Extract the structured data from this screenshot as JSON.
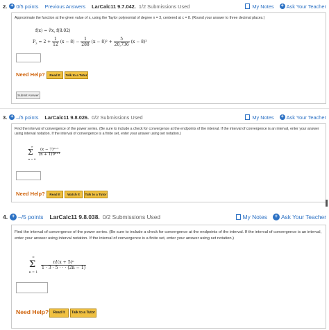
{
  "q2": {
    "number": "2.",
    "points": "0/5 points",
    "previous": "Previous Answers",
    "code": "LarCalc11 9.7.042.",
    "submissions": "1/2 Submissions Used",
    "my_notes": "My Notes",
    "ask_teacher": "Ask Your Teacher",
    "instructions": "Approximate the function at the given value of x, using the Taylor polynomial of degree n = 3, centered at c = 8. (Round your answer to three decimal places.)",
    "func": "f(x) = ∛x,  f(8.02)",
    "p3_lhs": "P",
    "p3_sub": "3",
    "p3_t0": "= 2 +",
    "p3_f1_num": "1",
    "p3_f1_den": "12",
    "p3_t1": "(x − 8) −",
    "p3_f2_num": "1",
    "p3_f2_den": "288",
    "p3_t2": "(x − 8)² +",
    "p3_f3_num": "5",
    "p3_f3_den": "20,736",
    "p3_t3": "(x − 8)³",
    "need_help": "Need Help?",
    "read_it": "Read It",
    "talk_tutor": "Talk to a Tutor",
    "submit": "Submit Answer"
  },
  "q3": {
    "number": "3.",
    "points": "–/5 points",
    "code": "LarCalc11 9.8.026.",
    "submissions": "0/2 Submissions Used",
    "my_notes": "My Notes",
    "ask_teacher": "Ask Your Teacher",
    "instructions": "Find the interval of convergence of the power series. (Be sure to include a check for convergence at the endpoints of the interval. If the interval of convergence is an interval, enter your answer using interval notation. If the interval of convergence is a finite set, enter your answer using set notation.)",
    "sum_top": "∞",
    "sum_bottom": "n = 0",
    "num": "(x − 7)ⁿ⁺¹",
    "den": "(n + 1)9ⁿ⁺¹",
    "need_help": "Need Help?",
    "read_it": "Read It",
    "watch_it": "Watch It",
    "talk_tutor": "Talk to a Tutor"
  },
  "q4": {
    "number": "4.",
    "points": "–/5 points",
    "code": "LarCalc11 9.8.038.",
    "submissions": "0/2 Submissions Used",
    "my_notes": "My Notes",
    "ask_teacher": "Ask Your Teacher",
    "instructions": "Find the interval of convergence of the power series. (Be sure to include a check for convergence at the endpoints of the interval. If the interval of convergence is an interval, enter your answer using interval notation. If the interval of convergence is a finite set, enter your answer using set notation.)",
    "sum_top": "∞",
    "sum_bottom": "n = 1",
    "num": "n!(x + 5)ⁿ",
    "den": "1 · 3 · 5 · · · (2n − 1)",
    "need_help": "Need Help?",
    "read_it": "Read It",
    "talk_tutor": "Talk to a Tutor"
  }
}
